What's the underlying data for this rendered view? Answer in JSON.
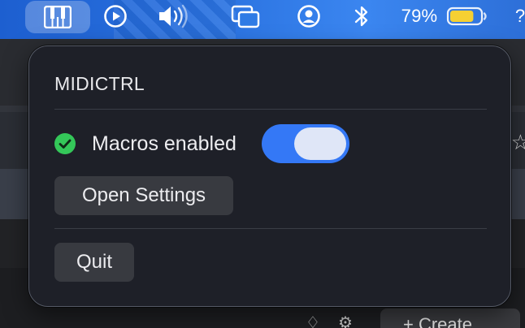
{
  "menubar": {
    "battery_percent": "79%",
    "overflow_glyph": "?",
    "icons": {
      "app": "piano-keys-icon",
      "play": "play-circle-icon",
      "volume": "speaker-volume-icon",
      "screens": "screen-mirroring-icon",
      "user": "user-account-icon",
      "bluetooth": "bluetooth-icon",
      "battery": "battery-icon"
    },
    "battery_level": 0.79,
    "battery_color": "#f5d033"
  },
  "popover": {
    "title": "MIDICTRL",
    "macros": {
      "label": "Macros enabled",
      "enabled": true,
      "status_icon": "check-circle-icon",
      "status_color": "#34c759",
      "toggle_color": "#3478f6"
    },
    "open_settings_label": "Open Settings",
    "quit_label": "Quit"
  },
  "background": {
    "create_label": "+ Create"
  }
}
